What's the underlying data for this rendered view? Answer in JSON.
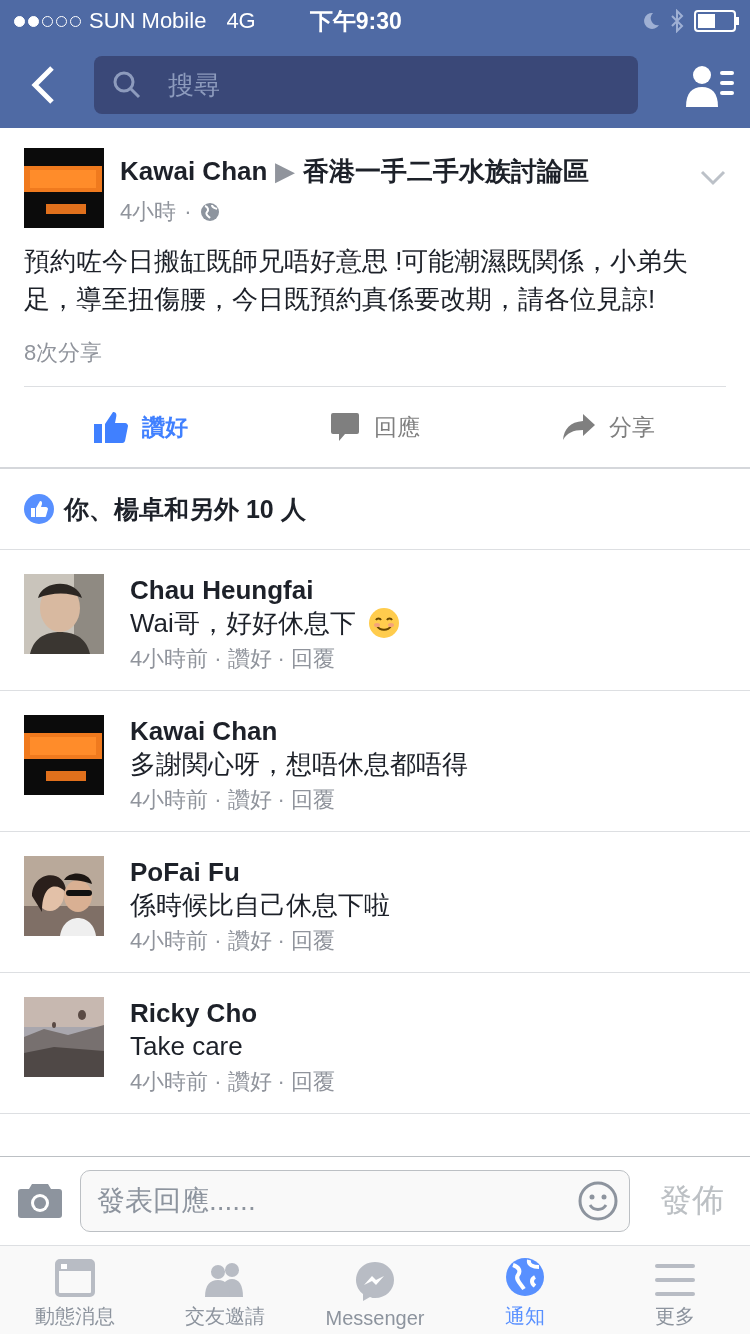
{
  "status_bar": {
    "carrier": "SUN Mobile",
    "network": "4G",
    "time": "下午9:30"
  },
  "nav": {
    "search": {
      "placeholder": "搜尋"
    }
  },
  "post": {
    "author": "Kawai Chan",
    "separator": "▶",
    "group": "香港一手二手水族討論區",
    "time": "4小時",
    "dot": "·",
    "text": "預約咗今日搬缸既師兄唔好意思 !可能潮濕既関係，小弟失足，導至扭傷腰，今日既預約真係要改期，請各位見諒!",
    "shares": "8次分享",
    "actions": [
      {
        "kind": "like",
        "label": "讚好",
        "selected": true
      },
      {
        "kind": "comment",
        "label": "回應",
        "selected": false
      },
      {
        "kind": "share",
        "label": "分享",
        "selected": false
      }
    ],
    "likes": "你、楊卓和另外 10 人"
  },
  "comments": [
    {
      "name": "Chau Heungfai",
      "text": "Wai哥，好好休息下",
      "has_emoji": true,
      "time": "4小時前",
      "dot1": "·",
      "like": "讚好",
      "dot2": "·",
      "reply": "回覆"
    },
    {
      "name": "Kawai Chan",
      "text": "多謝関心呀，想唔休息都唔得",
      "has_emoji": false,
      "time": "4小時前",
      "dot1": "·",
      "like": "讚好",
      "dot2": "·",
      "reply": "回覆"
    },
    {
      "name": "PoFai Fu",
      "text": "係時候比自己休息下啦",
      "has_emoji": false,
      "time": "4小時前",
      "dot1": "·",
      "like": "讚好",
      "dot2": "·",
      "reply": "回覆"
    },
    {
      "name": "Ricky Cho",
      "text": "Take care",
      "has_emoji": false,
      "time": "4小時前",
      "dot1": "·",
      "like": "讚好",
      "dot2": "·",
      "reply": "回覆"
    }
  ],
  "composer": {
    "placeholder": "發表回應......",
    "send": "發佈"
  },
  "tabs": [
    {
      "kind": "feed",
      "label": "動態消息",
      "selected": false
    },
    {
      "kind": "friends",
      "label": "交友邀請",
      "selected": false
    },
    {
      "kind": "messenger",
      "label": "Messenger",
      "selected": false
    },
    {
      "kind": "globe",
      "label": "通知",
      "selected": true
    },
    {
      "kind": "more",
      "label": "更多",
      "selected": false
    }
  ]
}
